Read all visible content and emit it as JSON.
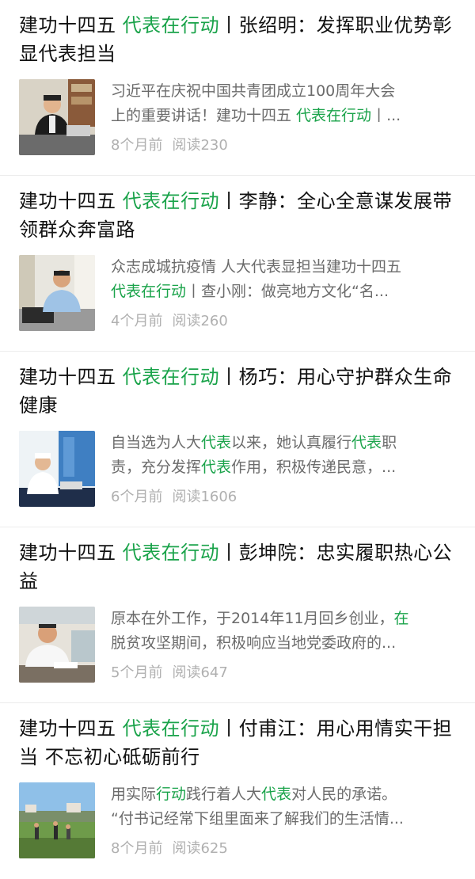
{
  "articles": [
    {
      "title_prefix": "建功十四五 ",
      "title_highlight": "代表在行动",
      "title_suffix": "丨张绍明：发挥职业优势彰显代表担当",
      "snippet_line1": [
        {
          "t": "习近平在庆祝中国共青团成立100周年大会",
          "h": false
        }
      ],
      "snippet_line2": [
        {
          "t": "上的重要讲话！建功十四五 ",
          "h": false
        },
        {
          "t": "代表在行动",
          "h": true
        },
        {
          "t": "丨...",
          "h": false
        }
      ],
      "time": "8个月前",
      "reads": "阅读230",
      "thumb_icon": "man-at-desk-photo"
    },
    {
      "title_prefix": "建功十四五 ",
      "title_highlight": "代表在行动",
      "title_suffix": "丨李静：全心全意谋发展带领群众奔富路",
      "snippet_line1": [
        {
          "t": "众志成城抗疫情 人大代表显担当建功十四五",
          "h": false
        }
      ],
      "snippet_line2": [
        {
          "t": "代表在行动",
          "h": true
        },
        {
          "t": "丨查小刚：做亮地方文化“名...",
          "h": false
        }
      ],
      "time": "4个月前",
      "reads": "阅读260",
      "thumb_icon": "man-at-computer-photo"
    },
    {
      "title_prefix": "建功十四五 ",
      "title_highlight": "代表在行动",
      "title_suffix": "丨杨巧：用心守护群众生命健康",
      "snippet_line1": [
        {
          "t": "自当选为人大",
          "h": false
        },
        {
          "t": "代表",
          "h": true
        },
        {
          "t": "以来，她认真履行",
          "h": false
        },
        {
          "t": "代表",
          "h": true
        },
        {
          "t": "职",
          "h": false
        }
      ],
      "snippet_line2": [
        {
          "t": "责，充分发挥",
          "h": false
        },
        {
          "t": "代表",
          "h": true
        },
        {
          "t": "作用，积极传递民意，...",
          "h": false
        }
      ],
      "time": "6个月前",
      "reads": "阅读1606",
      "thumb_icon": "nurse-photo"
    },
    {
      "title_prefix": "建功十四五 ",
      "title_highlight": "代表在行动",
      "title_suffix": "丨彭坤院：忠实履职热心公益",
      "snippet_line1": [
        {
          "t": "原本在外工作，于2014年11月回乡创业，",
          "h": false
        },
        {
          "t": "在",
          "h": true
        }
      ],
      "snippet_line2": [
        {
          "t": "脱贫攻坚期间，积极响应当地党委政府的...",
          "h": false
        }
      ],
      "time": "5个月前",
      "reads": "阅读647",
      "thumb_icon": "man-writing-photo"
    },
    {
      "title_prefix": "建功十四五 ",
      "title_highlight": "代表在行动",
      "title_suffix": "丨付甫江：用心用情实干担当 不忘初心砥砺前行",
      "snippet_line1": [
        {
          "t": "用实际",
          "h": false
        },
        {
          "t": "行动",
          "h": true
        },
        {
          "t": "践行着人大",
          "h": false
        },
        {
          "t": "代表",
          "h": true
        },
        {
          "t": "对人民的承诺。",
          "h": false
        }
      ],
      "snippet_line2": [
        {
          "t": "“付书记经常下组里面来了解我们的生活情...",
          "h": false
        }
      ],
      "time": "8个月前",
      "reads": "阅读625",
      "thumb_icon": "village-field-photo"
    }
  ],
  "colors": {
    "highlight": "#1aa34a",
    "meta": "#b0b0b0",
    "snippet": "#6b6b6b"
  }
}
